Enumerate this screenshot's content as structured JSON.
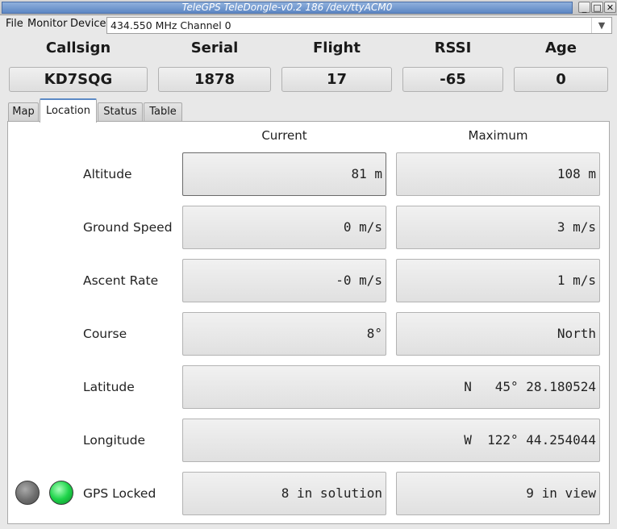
{
  "window": {
    "title": "TeleGPS TeleDongle-v0.2 186 /dev/ttyACM0",
    "minimize_glyph": "_",
    "maximize_glyph": "□",
    "close_glyph": "✕"
  },
  "menu": {
    "file": "File",
    "monitor": "Monitor",
    "device": "Device"
  },
  "device_select": {
    "value": "434.550 MHz Channel 0"
  },
  "header": {
    "fields": [
      {
        "label": "Callsign",
        "value": "KD7SQG"
      },
      {
        "label": "Serial",
        "value": "1878"
      },
      {
        "label": "Flight",
        "value": "17"
      },
      {
        "label": "RSSI",
        "value": "-65"
      },
      {
        "label": "Age",
        "value": "0"
      }
    ]
  },
  "tabs": [
    {
      "label": "Map",
      "active": false
    },
    {
      "label": "Location",
      "active": true
    },
    {
      "label": "Status",
      "active": false
    },
    {
      "label": "Table",
      "active": false
    }
  ],
  "location": {
    "col_current": "Current",
    "col_maximum": "Maximum",
    "altitude": {
      "label": "Altitude",
      "current": "81 m",
      "maximum": "108 m"
    },
    "ground_speed": {
      "label": "Ground Speed",
      "current": "0 m/s",
      "maximum": "3 m/s"
    },
    "ascent_rate": {
      "label": "Ascent Rate",
      "current": "-0 m/s",
      "maximum": "1 m/s"
    },
    "course": {
      "label": "Course",
      "current": "8°",
      "maximum": "North"
    },
    "latitude": {
      "label": "Latitude",
      "value": "N   45° 28.180524"
    },
    "longitude": {
      "label": "Longitude",
      "value": "W  122° 44.254044"
    },
    "gps": {
      "label": "GPS Locked",
      "current": "8 in solution",
      "maximum": "9 in view",
      "led_colors": [
        "#6d6d6d",
        "#1ed44a"
      ]
    }
  }
}
